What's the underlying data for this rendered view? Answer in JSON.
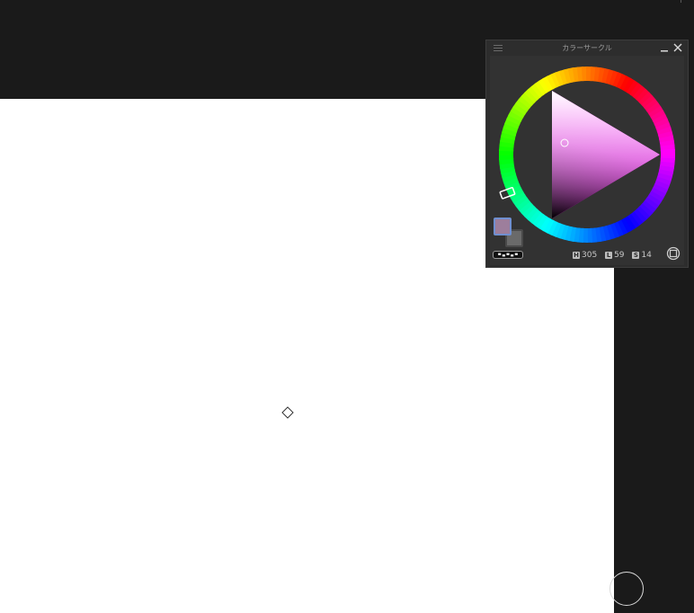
{
  "colors": {
    "app_background": "#1a1a1a",
    "canvas": "#ffffff",
    "panel_background": "#2d2d2d",
    "main_color": "#9d7e9c",
    "sub_color": "#6a6a6a"
  },
  "panel": {
    "title": "カラーサークル",
    "hue_label": "H",
    "hue_value": "305",
    "lightness_label": "L",
    "lightness_value": "59",
    "saturation_label": "S",
    "saturation_value": "14"
  },
  "icons": {
    "menu": "hamburger-icon",
    "minimize": "minimize-icon",
    "close": "close-icon",
    "mode": "color-space-toggle-icon",
    "canvas_cursor": "brush-cursor-icon"
  }
}
